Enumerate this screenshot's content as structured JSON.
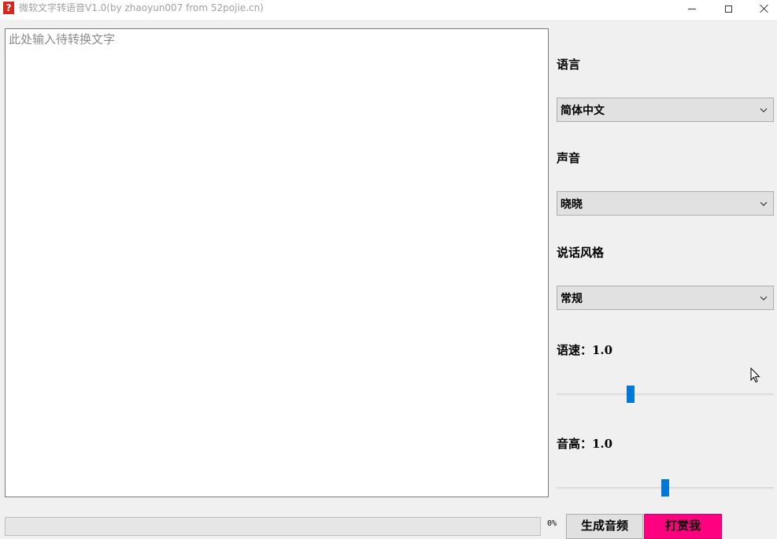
{
  "window": {
    "title": "微软文字转语音V1.0(by zhaoyun007 from 52pojie.cn)",
    "icon_glyph": "?",
    "icon": "app-question-icon",
    "controls": [
      "minimize-icon",
      "maximize-icon",
      "close-icon"
    ]
  },
  "editor": {
    "value": "",
    "placeholder": "此处输入待转换文字"
  },
  "panel": {
    "language_label": "语言",
    "language_value": "简体中文",
    "voice_label": "声音",
    "voice_value": "晓晓",
    "style_label": "说话风格",
    "style_value": "常规",
    "rate_label": "语速：1.0",
    "rate_level": 0.34,
    "pitch_label": "音高：1.0",
    "pitch_level": 0.5
  },
  "footer": {
    "progress_value": 0,
    "progress_text": "0%",
    "generate_label": "生成音频",
    "donate_label": "打赏我"
  },
  "colors": {
    "accent": "#0078d7",
    "donate": "#ff0080",
    "progress_fill": "#06b025"
  }
}
